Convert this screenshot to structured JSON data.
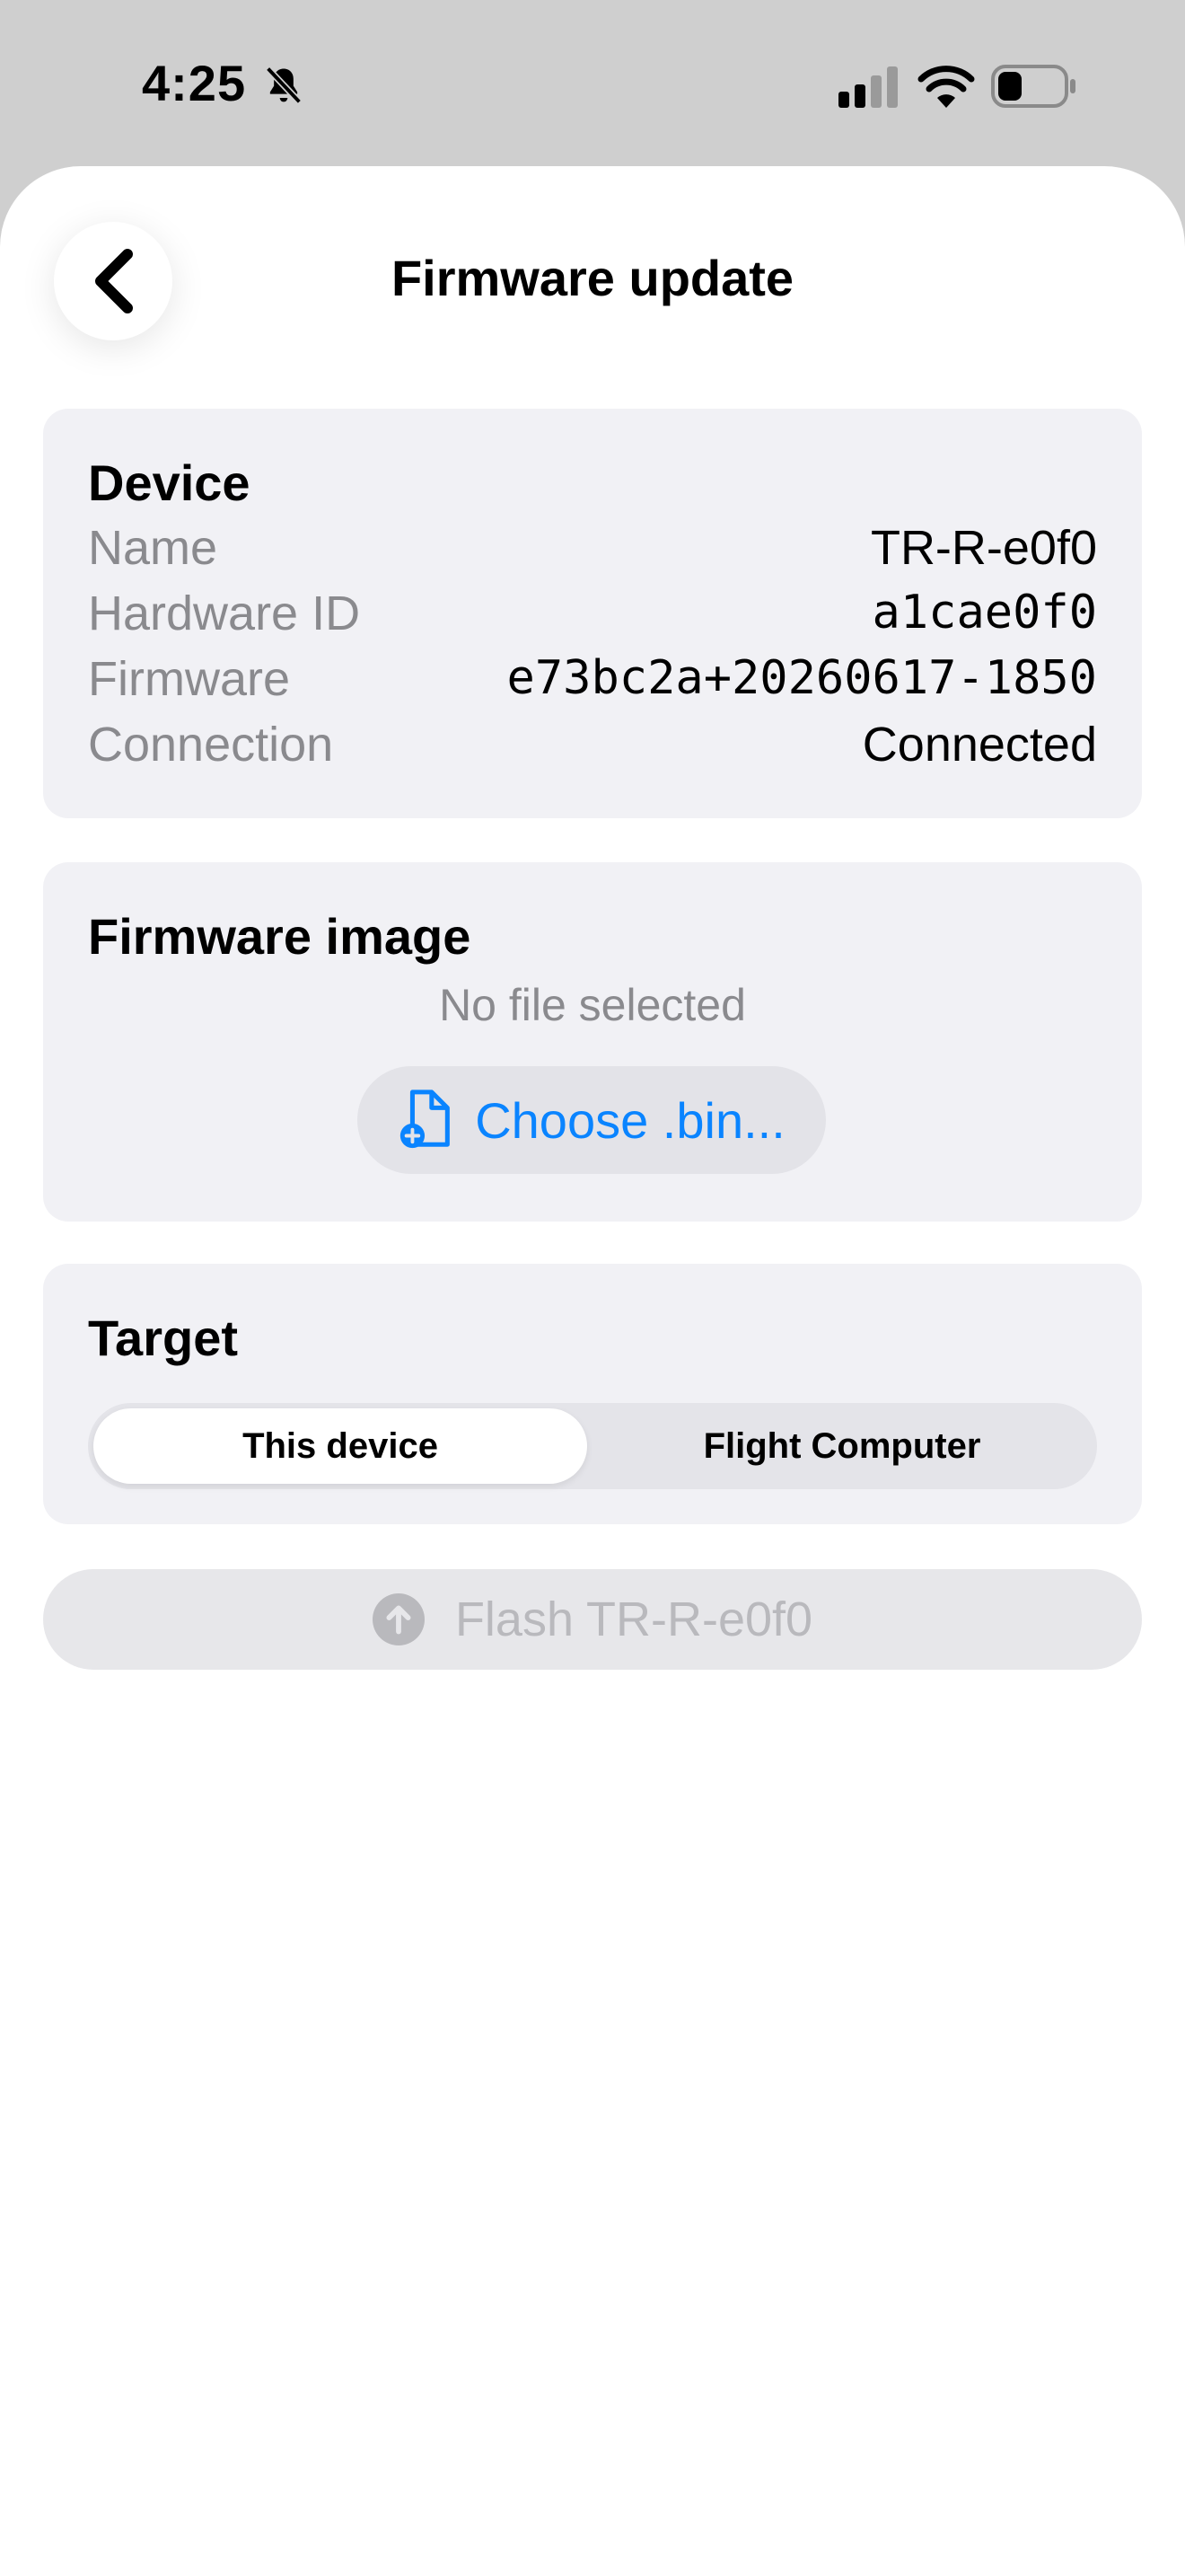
{
  "status_bar": {
    "time": "4:25",
    "icons": [
      "bell-slash-icon",
      "cellular-signal-icon",
      "wifi-icon",
      "battery-icon"
    ]
  },
  "nav": {
    "back_icon": "chevron-left-icon",
    "title": "Firmware update"
  },
  "device": {
    "title": "Device",
    "rows": [
      {
        "label": "Name",
        "value": "TR-R-e0f0"
      },
      {
        "label": "Hardware ID",
        "value": "a1cae0f0"
      },
      {
        "label": "Firmware",
        "value": "e73bc2a+20260617-1850"
      },
      {
        "label": "Connection",
        "value": "Connected"
      }
    ]
  },
  "firmware_image": {
    "title": "Firmware image",
    "status": "No file selected",
    "choose_label": "Choose .bin...",
    "choose_icon": "doc-badge-plus-icon"
  },
  "target": {
    "title": "Target",
    "options": [
      "This device",
      "Flight Computer"
    ],
    "selected": "This device"
  },
  "flash": {
    "label": "Flash TR-R-e0f0",
    "icon": "arrow-up-circle-icon",
    "enabled": false
  },
  "colors": {
    "accent": "#0a84ff",
    "card_background": "#f1f1f5",
    "secondary_text": "#8a8a8e",
    "disabled_text": "#b9b9bd"
  }
}
